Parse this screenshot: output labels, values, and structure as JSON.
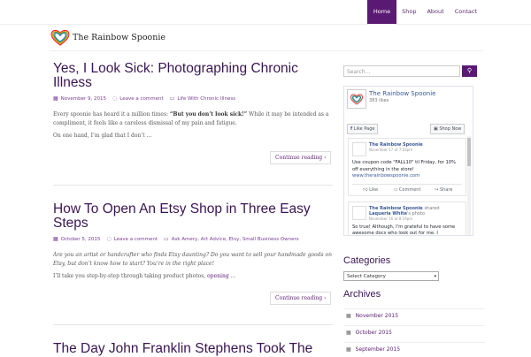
{
  "nav": {
    "items": [
      {
        "label": "Home",
        "active": true
      },
      {
        "label": "Shop",
        "active": false
      },
      {
        "label": "About",
        "active": false
      },
      {
        "label": "Contact",
        "active": false
      }
    ]
  },
  "site": {
    "logo_text": "The Rainbow Spoonie"
  },
  "posts": [
    {
      "title": "Yes, I Look Sick: Photographing Chronic Illness",
      "date": "November 9, 2015",
      "comments": "Leave a comment",
      "tags": "Life With Chronic Illness",
      "p1_pre": "Every spoonie has heard it a million times: ",
      "p1_bold": "“But you don’t look sick!”",
      "p1_post": " While it may be intended as a compliment, it feels like a careless dismissal of my pain and fatigue.",
      "p2": "On one hand, I’m glad that I don’t …",
      "more": "Continue reading"
    },
    {
      "title": "How To Open An Etsy Shop in Three Easy Steps",
      "date": "October 5, 2015",
      "comments": "Leave a comment",
      "tags": "Ask Amery, Art Advice, Etsy, Small Business Owners",
      "p1_italic": "Are you an artist or handcrafter who finds Etsy daunting? Do you want to sell your handmade goods on Etsy, but don’t know how to start? You’re in the right place!",
      "p2_pre": "I’ll take you step-by-step through taking product photos, ",
      "p2_link": "opening",
      "p2_post": " …",
      "more": "Continue reading"
    },
    {
      "title": "The Day John Franklin Stephens Took The"
    }
  ],
  "sidebar": {
    "search_placeholder": "Search...",
    "facebook": {
      "page_name": "The Rainbow Spoonie",
      "likes": "383 likes",
      "like_btn": "Like Page",
      "shop_btn": "Shop Now",
      "feed": [
        {
          "name": "The Rainbow Spoonie",
          "date": "November 17 at 7:03pm",
          "text": "Use coupon code \"FALL10\" til Friday, for 10% off everything in the store!",
          "link": "www.therainbowspoonie.com",
          "actions": [
            "Like",
            "Comment",
            "Share"
          ]
        },
        {
          "name": "The Rainbow Spoonie",
          "shared": "shared",
          "shared_from": "Laqueria White",
          "shared_suffix": "'s photo",
          "date": "November 16 at 8:19pm",
          "text": "So true! Although, I'm grateful to have some awesome docs who look out for me. I"
        }
      ]
    },
    "categories_title": "Categories",
    "categories_select": "Select Category",
    "archives_title": "Archives",
    "archives": [
      "November 2015",
      "October 2015",
      "September 2015"
    ]
  }
}
